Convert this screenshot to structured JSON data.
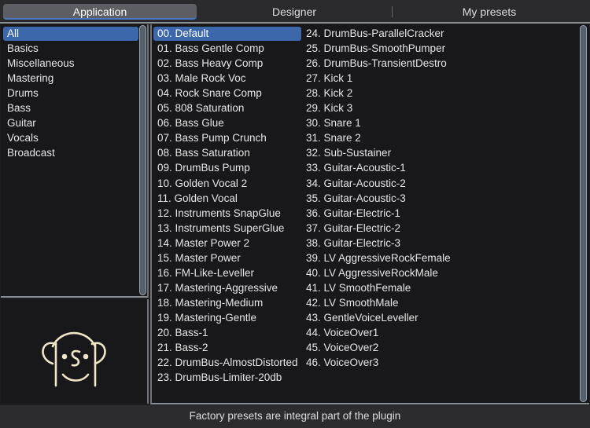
{
  "tabs": [
    "Application",
    "Designer",
    "My presets"
  ],
  "categories": [
    "All",
    "Basics",
    "Miscellaneous",
    "Mastering",
    "Drums",
    "Bass",
    "Guitar",
    "Vocals",
    "Broadcast"
  ],
  "presets": [
    "00. Default",
    "01. Bass Gentle Comp",
    "02. Bass Heavy Comp",
    "03. Male Rock Voc",
    "04. Rock Snare Comp",
    "05. 808 Saturation",
    "06. Bass Glue",
    "07. Bass Pump Crunch",
    "08. Bass Saturation",
    "09. DrumBus Pump",
    "10. Golden Vocal 2",
    "11. Golden Vocal",
    "12. Instruments SnapGlue",
    "13. Instruments SuperGlue",
    "14. Master Power 2",
    "15. Master Power",
    "16. FM-Like-Leveller",
    "17. Mastering-Aggressive",
    "18. Mastering-Medium",
    "19. Mastering-Gentle",
    "20. Bass-1",
    "21. Bass-2",
    "22. DrumBus-AlmostDistorted",
    "23. DrumBus-Limiter-20db",
    "24. DrumBus-ParallelCracker",
    "25. DrumBus-SmoothPumper",
    "26. DrumBus-TransientDestro",
    "27. Kick 1",
    "28. Kick 2",
    "29. Kick 3",
    "30. Snare 1",
    "31. Snare 2",
    "32. Sub-Sustainer",
    "33. Guitar-Acoustic-1",
    "34. Guitar-Acoustic-2",
    "35. Guitar-Acoustic-3",
    "36. Guitar-Electric-1",
    "37. Guitar-Electric-2",
    "38. Guitar-Electric-3",
    "39. LV AggressiveRockFemale",
    "40. LV AggressiveRockMale",
    "41. LV SmoothFemale",
    "42. LV SmoothMale",
    "43. GentleVoiceLeveller",
    "44. VoiceOver1",
    "45. VoiceOver2",
    "46. VoiceOver3"
  ],
  "selected_category": "All",
  "selected_preset": "00. Default",
  "status": "Factory presets are integral part of the plugin",
  "colors": {
    "selection": "#3c67ab",
    "logo": "#efe6c8"
  }
}
